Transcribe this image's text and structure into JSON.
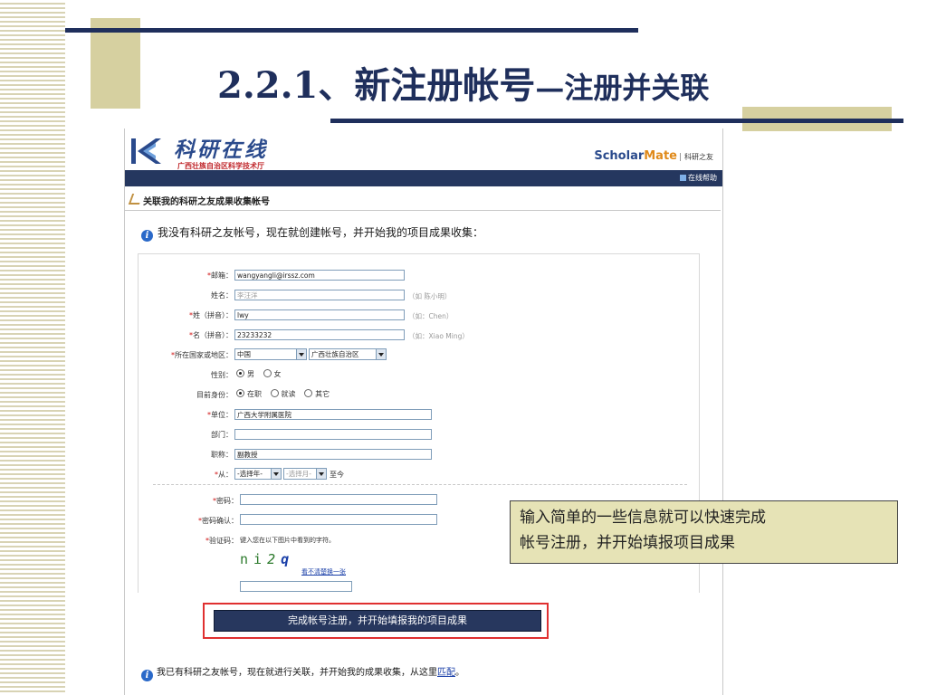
{
  "slide": {
    "title_main": "2.2.1、新注册帐号",
    "title_sub": "—注册并关联"
  },
  "site": {
    "name": "科研在线",
    "org": "广西壮族自治区科学技术厅",
    "brand_part1": "Sch",
    "brand_part2": "o",
    "brand_part3": "lar",
    "brand_part4": "Mate",
    "brand_friend": "科研之友",
    "help_link": "在线帮助",
    "section_label": "关联我的科研之友成果收集帐号"
  },
  "notice_top": "我没有科研之友帐号，现在就创建帐号，并开始我的项目成果收集：",
  "form": {
    "email": {
      "label": "邮箱：",
      "value": "wangyangli@irssz.com"
    },
    "name": {
      "label": "姓名：",
      "value": "李汪洋",
      "hint": "（如 陈小明）"
    },
    "surname_pinyin": {
      "label": "姓（拼音）：",
      "value": "lwy",
      "hint": "（如：Chen）"
    },
    "given_pinyin": {
      "label": "名（拼音）：",
      "value": "23233232",
      "hint": "（如：Xiao Ming）"
    },
    "region": {
      "label": "所在国家或地区：",
      "country": "中国",
      "province": "广西壮族自治区"
    },
    "gender": {
      "label": "性别：",
      "options": [
        "男",
        "女"
      ],
      "selected": "男"
    },
    "identity": {
      "label": "目前身份：",
      "options": [
        "在职",
        "就读",
        "其它"
      ],
      "selected": "在职"
    },
    "unit": {
      "label": "单位：",
      "value": "广西大学附属医院"
    },
    "dept": {
      "label": "部门：",
      "value": ""
    },
    "title": {
      "label": "职称：",
      "value": "副教授"
    },
    "from": {
      "label": "从：",
      "year": "-选择年-",
      "month": "-选择月-",
      "to_now": "至今"
    },
    "password": {
      "label": "密码：",
      "value": ""
    },
    "password_confirm": {
      "label": "密码确认：",
      "value": ""
    },
    "captcha": {
      "label": "验证码：",
      "instruction": "键入您在以下图片中看到的字符。",
      "chars": [
        "n",
        "i",
        "2",
        "q"
      ],
      "refresh": "看不清楚换一张",
      "value": ""
    }
  },
  "submit_label": "完成帐号注册，并开始填报我的项目成果",
  "notice_bottom": {
    "text": "我已有科研之友帐号，现在就进行关联，并开始我的成果收集，从这里",
    "link": "匹配",
    "end": "。"
  },
  "callout": {
    "line1": "输入简单的一些信息就可以快速完成",
    "line2": "帐号注册，并开始填报项目成果"
  },
  "colors": {
    "navy": "#1f2f5c",
    "beige": "#d6d0a0",
    "callout_bg": "#e6e3b6",
    "required": "#d01010",
    "submit_frame": "#e03030"
  }
}
